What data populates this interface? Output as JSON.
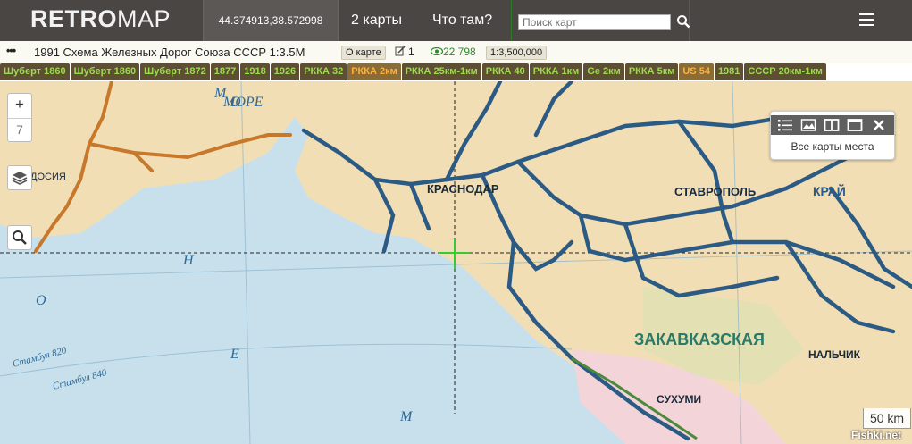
{
  "header": {
    "logo_main": "RETRO",
    "logo_accent": "MAP",
    "coordinates": "44.374913,38.572998",
    "nav_maps": "2 карты",
    "nav_what": "Что там?",
    "search_placeholder": "Поиск карт"
  },
  "info": {
    "more": "•••",
    "title": "1991 Схема Железных Дорог Союза СССР 1:3.5M",
    "about": "О карте",
    "edits": "1",
    "views": "22 798",
    "scale": "1:3,500,000"
  },
  "tabs": [
    {
      "label": "Шуберт 1860",
      "active": false
    },
    {
      "label": "Шуберт 1860",
      "active": false
    },
    {
      "label": "Шуберт 1872",
      "active": false
    },
    {
      "label": "1877",
      "active": false
    },
    {
      "label": "1918",
      "active": false
    },
    {
      "label": "1926",
      "active": false
    },
    {
      "label": "РККА 32",
      "active": false
    },
    {
      "label": "РККА 2км",
      "active": true
    },
    {
      "label": "РККА 25км-1км",
      "active": false
    },
    {
      "label": "РККА 40",
      "active": false
    },
    {
      "label": "РККА 1км",
      "active": false
    },
    {
      "label": "Ge 2км",
      "active": false
    },
    {
      "label": "РККА 5км",
      "active": false
    },
    {
      "label": "US 54",
      "active": true
    },
    {
      "label": "1981",
      "active": false
    },
    {
      "label": "СССР 20км-1км",
      "active": false
    }
  ],
  "map_labels": {
    "sea_m": "М",
    "sea_o": "О",
    "sea_r": "Р",
    "sea_e": "Е",
    "sea_more": "МОРЕ",
    "sea_n": "Н",
    "sea_oe": "О",
    "sea_e2": "Е",
    "sea_m2": "М",
    "krasnodar": "КРАСНОДАР",
    "stavropol": "СТАВРОПОЛЬ",
    "zakavkaz": "ЗАКАВКАЗСКАЯ",
    "nalchik": "НАЛЬЧИК",
    "sukhumi": "СУХУМИ",
    "feodosiya": "ФЕОДОСИЯ",
    "route_820": "Стамбул 820",
    "route_840": "Стамбул 840",
    "krai": "КРАЙ"
  },
  "controls": {
    "zoom_in": "+",
    "zoom_level": "7"
  },
  "panel": {
    "all_maps": "Все карты места"
  },
  "scale_bar": "50 km",
  "watermark": "Fishki.net",
  "colors": {
    "header_bg": "#4a4643",
    "tab_bg": "#5e4e34",
    "tab_text": "#9edb4f",
    "tab_active_text": "#ffb040",
    "sea": "#c8e0ec",
    "land": "#f2deb4",
    "railway": "#2b5a84",
    "old_railway": "#c8782a",
    "crosshair": "#33cc33"
  }
}
